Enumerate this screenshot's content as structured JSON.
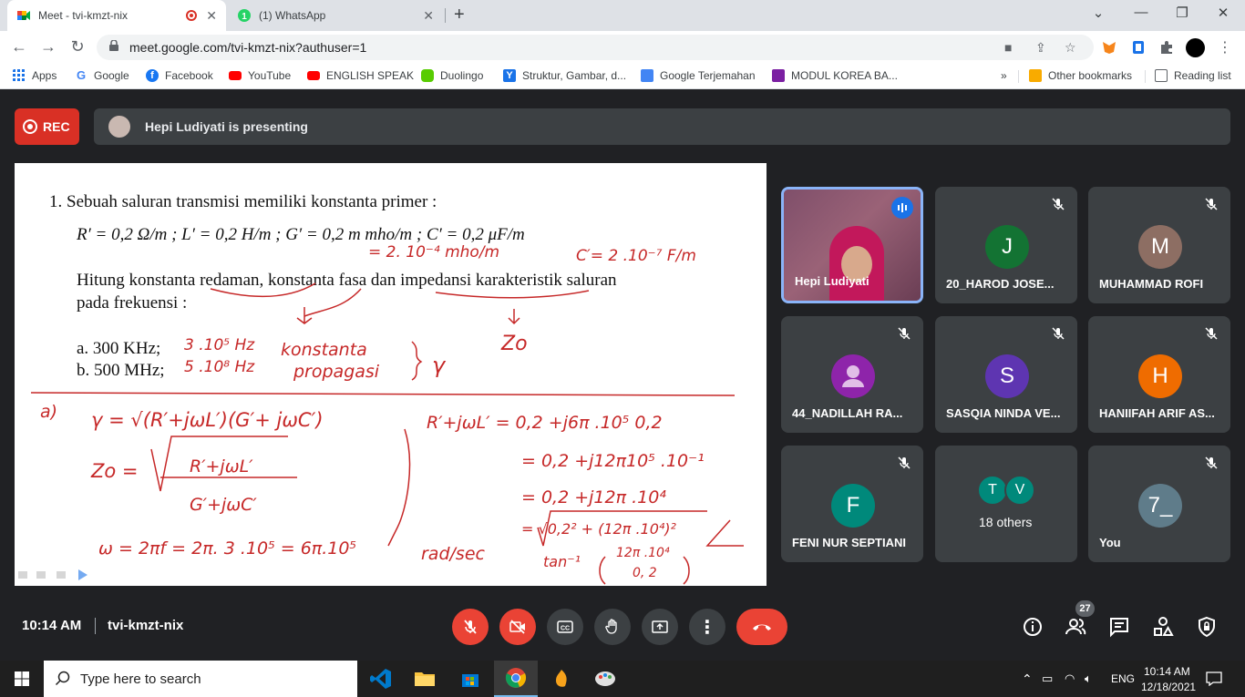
{
  "browser": {
    "tabs": [
      {
        "title": "Meet - tvi-kmzt-nix"
      },
      {
        "title": "(1) WhatsApp"
      }
    ],
    "new_tab": "+",
    "url": "meet.google.com/tvi-kmzt-nix?authuser=1",
    "bookmarks": [
      {
        "label": "Apps",
        "icon": "apps-grid-icon",
        "color": "#1a73e8"
      },
      {
        "label": "Google",
        "icon": "google-icon",
        "color": "#4285f4"
      },
      {
        "label": "Facebook",
        "icon": "facebook-icon",
        "color": "#1877f2"
      },
      {
        "label": "YouTube",
        "icon": "youtube-icon",
        "color": "#ff0000"
      },
      {
        "label": "ENGLISH SPEAK",
        "icon": "youtube-icon",
        "color": "#ff0000"
      },
      {
        "label": "Duolingo",
        "icon": "duolingo-icon",
        "color": "#58cc02"
      },
      {
        "label": "Struktur, Gambar, d...",
        "icon": "y-bookmark-icon",
        "color": "#1a73e8"
      },
      {
        "label": "Google Terjemahan",
        "icon": "translate-icon",
        "color": "#4285f4"
      },
      {
        "label": "MODUL KOREA BA...",
        "icon": "modul-icon",
        "color": "#7b1fa2"
      }
    ],
    "more_bookmarks": "»",
    "other_bookmarks": "Other bookmarks",
    "reading_list": "Reading list"
  },
  "meet": {
    "rec_label": "REC",
    "presenting_text": "Hepi Ludiyati is presenting",
    "slide": {
      "q1": "1.  Sebuah saluran transmisi memiliki konstanta primer :",
      "params": "R′ = 0,2 Ω/m   ; L′ = 0,2 H/m   ; G′ = 0,2 m mho/m   ; C′ = 0,2 μF/m",
      "hw_g": "= 2. 10⁻⁴  mho/m",
      "hw_c": "C′= 2 .10⁻⁷ F/m",
      "hitung1": "Hitung konstanta redaman, konstanta fasa dan impedansi karakteristik saluran",
      "hitung2": "pada frekuensi :",
      "opt_a": "a.  300 KHz;",
      "opt_b": "b.  500 MHz;",
      "hw_a": "3 .10⁵ Hz",
      "hw_b": "5 .10⁸ Hz",
      "hw_konstanta": "konstanta",
      "hw_propagasi": "propagasi",
      "hw_gamma": "γ",
      "hw_zo": "Zo",
      "hw_a_label": "a)",
      "hw_gamma_eq": "γ = √(R′+jωL′)(G′+ jωC′)",
      "hw_zo_eq": "Zo =",
      "hw_zo_num": "R′+jωL′",
      "hw_zo_den": "G′+jωC′",
      "hw_r1": "R′+jωL′ = 0,2 +j6π .10⁵ 0,2",
      "hw_r2": "= 0,2 +j12π10⁵ .10⁻¹",
      "hw_r3": "= 0,2 +j12π .10⁴",
      "hw_r4": "= √0,2² + (12π .10⁴)²",
      "hw_tan": "tan⁻¹",
      "hw_tan_num": "12π .10⁴",
      "hw_tan_den": "0, 2",
      "hw_omega": "ω = 2πf = 2π. 3 .10⁵ = 6π.10⁵",
      "hw_rad": "rad/sec"
    },
    "participants": [
      {
        "name": "Hepi Ludiyati",
        "initial": "",
        "color": "",
        "speaking": true
      },
      {
        "name": "20_HAROD JOSE...",
        "initial": "J",
        "color": "#137333"
      },
      {
        "name": "MUHAMMAD ROFI",
        "initial": "M",
        "color": "#8d6e63"
      },
      {
        "name": "44_NADILLAH RA...",
        "initial": "",
        "color": "#8e24aa"
      },
      {
        "name": "SASQIA NINDA VE...",
        "initial": "S",
        "color": "#5e35b1"
      },
      {
        "name": "HANIIFAH ARIF AS...",
        "initial": "H",
        "color": "#ef6c00"
      },
      {
        "name": "FENI NUR SEPTIANI",
        "initial": "F",
        "color": "#00897b"
      },
      {
        "name": "18 others",
        "initial": "T",
        "initial2": "V",
        "color": "#00897b"
      },
      {
        "name": "You",
        "initial": "7_",
        "color": "#5f7c8a"
      }
    ],
    "time": "10:14 AM",
    "meeting_code": "tvi-kmzt-nix",
    "participant_count": "27"
  },
  "taskbar": {
    "search_placeholder": "Type here to search",
    "lang": "ENG",
    "clock_time": "10:14 AM",
    "clock_date": "12/18/2021"
  }
}
